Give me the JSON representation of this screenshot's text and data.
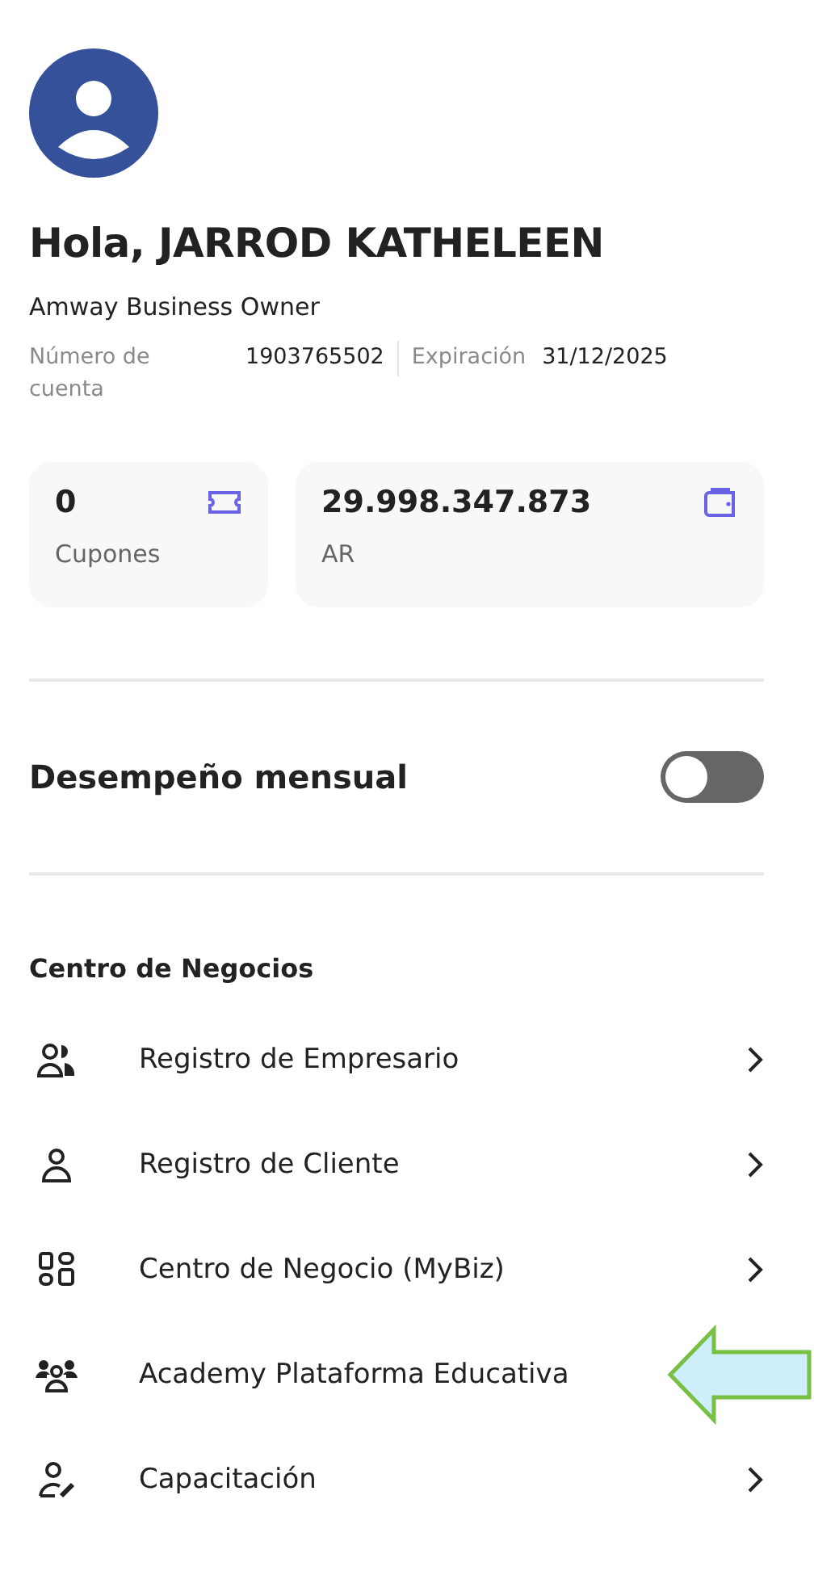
{
  "greeting": "Hola, JARROD KATHELEEN",
  "role": "Amway Business Owner",
  "account": {
    "number_label": "Número de cuenta",
    "number": "1903765502",
    "expiry_label": "Expiración",
    "expiry": "31/12/2025"
  },
  "cards": [
    {
      "kind": "coupon",
      "value": "0",
      "label": "Cupones"
    },
    {
      "kind": "wallet",
      "value": "29.998.347.873",
      "label": "AR"
    }
  ],
  "performance": {
    "label": "Desempeño mensual",
    "on": false
  },
  "section_title": "Centro de Negocios",
  "menu": [
    {
      "kind": "people",
      "label": "Registro de Empresario",
      "highlighted": false
    },
    {
      "kind": "person",
      "label": "Registro de Cliente",
      "highlighted": false
    },
    {
      "kind": "grid",
      "label": "Centro de Negocio (MyBiz)",
      "highlighted": false
    },
    {
      "kind": "group",
      "label": "Academy Plataforma Educativa",
      "highlighted": true
    },
    {
      "kind": "person-edit",
      "label": "Capacitación",
      "highlighted": false
    }
  ]
}
